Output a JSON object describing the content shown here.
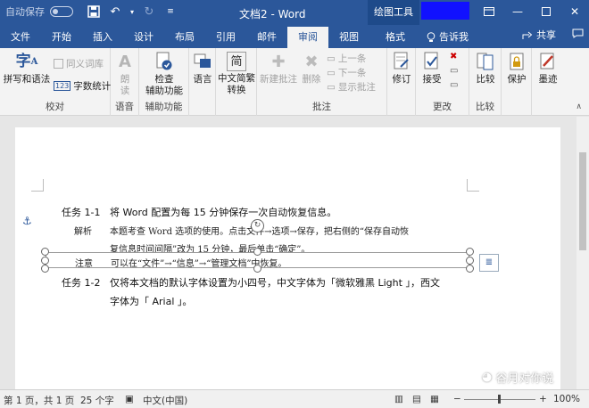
{
  "qat": {
    "autosave": "自动保存"
  },
  "window": {
    "title": "文档2 - Word",
    "context_tab": "绘图工具"
  },
  "tabs": [
    "文件",
    "开始",
    "插入",
    "设计",
    "布局",
    "引用",
    "邮件",
    "审阅",
    "视图",
    "格式"
  ],
  "tell_me": "告诉我",
  "share": "共享",
  "ribbon": {
    "spelling": "拼写和语法",
    "thesaurus": "同义词库",
    "wordcount": "字数统计",
    "proofing_label": "校对",
    "read_aloud": [
      "朗",
      "读"
    ],
    "speech_label": "语音",
    "check_access": [
      "检查",
      "辅助功能"
    ],
    "access_label": "辅助功能",
    "language": "语言",
    "trad_simp": [
      "中文简繁",
      "转换"
    ],
    "new_comment": "新建批注",
    "delete": "删除",
    "prev": "上一条",
    "next": "下一条",
    "show_comments": "显示批注",
    "comments_label": "批注",
    "track": "修订",
    "accept": "接受",
    "changes_label": "更改",
    "compare": "比较",
    "compare_label": "比较",
    "protect": "保护",
    "ink": "墨迹"
  },
  "doc": {
    "task1_label": "任务 1-1",
    "task1_text": "将 Word 配置为每 15 分钟保存一次自动恢复信息。",
    "jiexi_label": "解析",
    "jiexi_line1": "本题考查 Word 选项的使用。点击文件→选项→保存，把右侧的“保存自动恢",
    "jiexi_line2": "复信息时间间隔”改为 15 分钟，最后单击“确定”。",
    "zhuyi_label": "注意",
    "zhuyi_text": "可以在“文件”→“信息”→“管理文档”中恢复。",
    "task2_label": "任务 1-2",
    "task2_line1": "仅将本文档的默认字体设置为小四号，中文字体为「微软雅黑 Light 」，西文",
    "task2_line2": "字体为「 Arial 」。"
  },
  "status": {
    "page": "第 1 页，共 1 页",
    "words": "25 个字",
    "lang": "中文(中国)",
    "zoom": "100%",
    "watermark": "谷月对你说"
  }
}
